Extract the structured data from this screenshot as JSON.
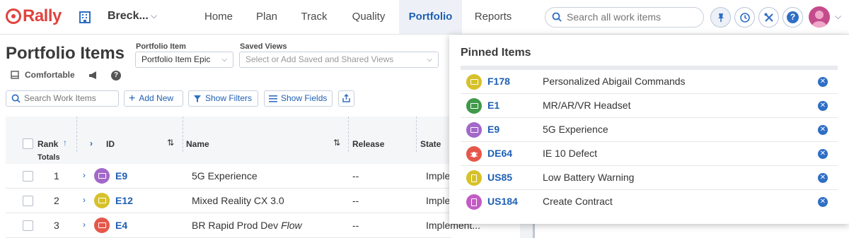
{
  "app": {
    "logo_text": "Rally",
    "workspace": "Breck..."
  },
  "nav": {
    "items": [
      {
        "label": "Home",
        "active": false
      },
      {
        "label": "Plan",
        "active": false
      },
      {
        "label": "Track",
        "active": false
      },
      {
        "label": "Quality",
        "active": false
      },
      {
        "label": "Portfolio",
        "active": true
      },
      {
        "label": "Reports",
        "active": false
      }
    ],
    "search_placeholder": "Search all work items"
  },
  "page": {
    "title": "Portfolio Items",
    "portfolio_item_label": "Portfolio Item",
    "portfolio_item_value": "Portfolio Item Epic",
    "saved_views_label": "Saved Views",
    "saved_views_placeholder": "Select or Add Saved and Shared Views",
    "density": "Comfortable",
    "search_placeholder": "Search Work Items",
    "add_new": "Add New",
    "show_filters": "Show Filters",
    "show_fields": "Show Fields"
  },
  "grid": {
    "columns": {
      "rank": "Rank",
      "id": "ID",
      "name": "Name",
      "release": "Release",
      "state": "State"
    },
    "totals_label": "Totals",
    "rows": [
      {
        "rank": "1",
        "id": "E9",
        "name": "5G Experience",
        "name_italic": "",
        "release": "--",
        "state": "Imple",
        "icon_color": "#a368c9"
      },
      {
        "rank": "2",
        "id": "E12",
        "name": "Mixed Reality CX 3.0",
        "name_italic": "",
        "release": "--",
        "state": "Imple",
        "icon_color": "#d6c12a"
      },
      {
        "rank": "3",
        "id": "E4",
        "name": "BR Rapid Prod Dev ",
        "name_italic": "Flow",
        "release": "--",
        "state": "Implement...",
        "icon_color": "#e5574a"
      }
    ]
  },
  "pinned": {
    "title": "Pinned Items",
    "items": [
      {
        "id": "F178",
        "name": "Personalized Abigail Commands",
        "icon": "feature-icon",
        "color": "#d6c12a"
      },
      {
        "id": "E1",
        "name": "MR/AR/VR Headset",
        "icon": "epic-icon",
        "color": "#3f9a4a"
      },
      {
        "id": "E9",
        "name": "5G Experience",
        "icon": "epic-icon",
        "color": "#a368c9"
      },
      {
        "id": "DE64",
        "name": "IE 10 Defect",
        "icon": "defect-icon",
        "color": "#e5574a"
      },
      {
        "id": "US85",
        "name": "Low Battery Warning",
        "icon": "story-icon",
        "color": "#d6c12a"
      },
      {
        "id": "US184",
        "name": "Create Contract",
        "icon": "story-icon",
        "color": "#c25cc4"
      }
    ]
  }
}
